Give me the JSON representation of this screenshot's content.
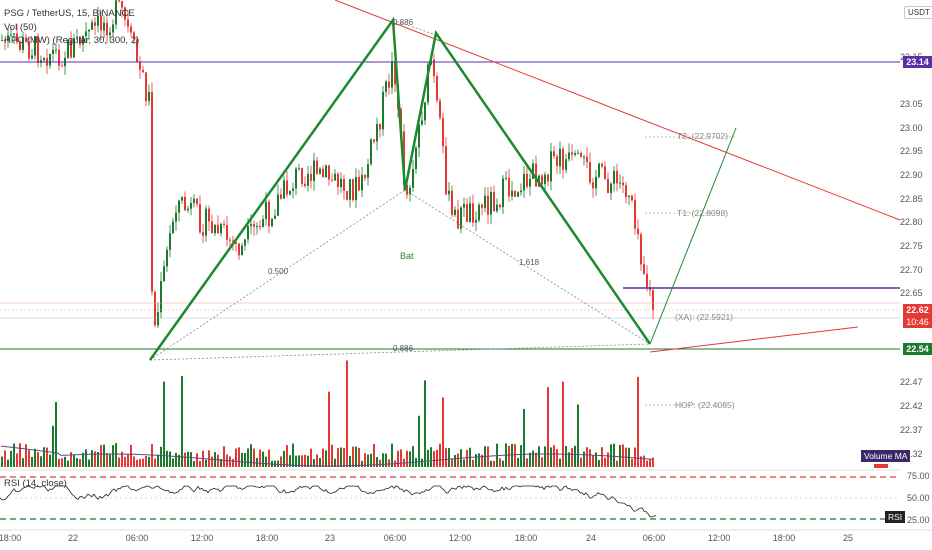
{
  "symbol": {
    "title": "PSG / TetherUS, 15, BINANCE",
    "volume_label": "Vol (50)",
    "hpc_label": "HPC (MW) (Regular, 30, 300, 2)",
    "currency": "USDT"
  },
  "price_axis": {
    "ticks": [
      "23.15",
      "23.05",
      "23.00",
      "22.95",
      "22.90",
      "22.85",
      "22.80",
      "22.75",
      "22.70",
      "22.65",
      "22.47",
      "22.42",
      "22.37",
      "22.32"
    ],
    "highlight_high": "23.14",
    "current_price": "22.62",
    "countdown": "10:46",
    "highlight_low": "22.54"
  },
  "rsi_axis": {
    "ticks": [
      "75.00",
      "50.00",
      "25.00"
    ],
    "tag": "RSI",
    "title": "RSI (14, close)"
  },
  "volume_tag": "Volume MA",
  "time_axis": [
    "18:00",
    "22",
    "06:00",
    "12:00",
    "18:00",
    "23",
    "06:00",
    "12:00",
    "18:00",
    "24",
    "06:00",
    "12:00",
    "18:00",
    "25"
  ],
  "pattern": {
    "name": "Bat",
    "ratios": [
      "0.886",
      "0.500",
      "1.618",
      "0.886"
    ]
  },
  "targets": {
    "t2": "T2: (22.9702)",
    "t1": "T1: (22.8098)",
    "xa": "(XA): (22.5921)",
    "hop": "HOP: (22.4085)"
  },
  "colors": {
    "up": "#1b7a2c",
    "down": "#e53935",
    "pattern": "#1b8a2e",
    "purple": "#5a2fa8",
    "resistance": "#e53935"
  }
}
